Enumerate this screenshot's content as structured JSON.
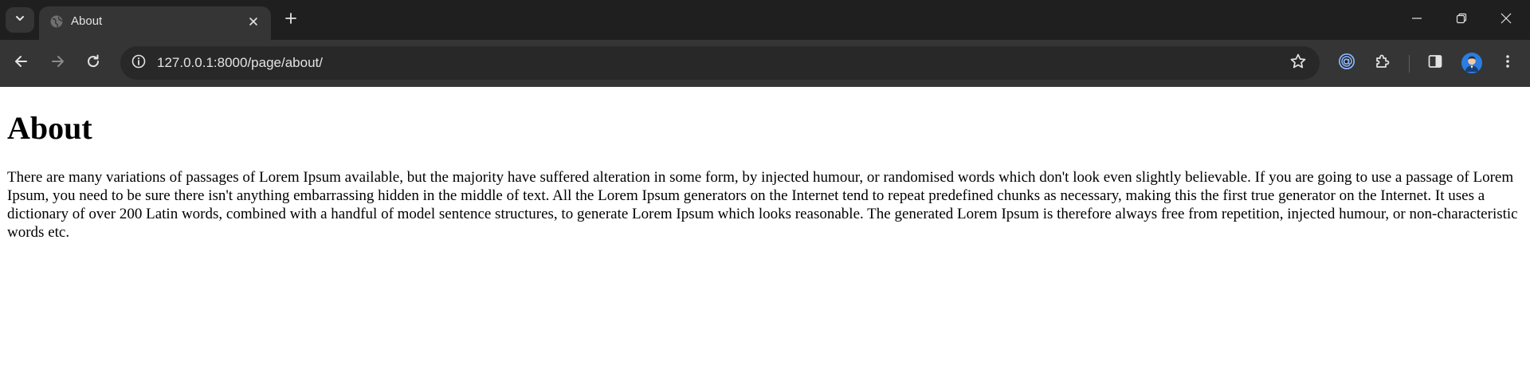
{
  "browser": {
    "tab": {
      "title": "About"
    },
    "address_bar": {
      "url": "127.0.0.1:8000/page/about/"
    },
    "icons": {
      "tab_search": "chevron-down-icon",
      "favicon": "globe-icon",
      "tab_close": "close-icon",
      "new_tab": "plus-icon",
      "minimize": "minimize-icon",
      "restore": "restore-icon",
      "close_window": "close-icon",
      "back": "arrow-left-icon",
      "forward": "arrow-right-icon",
      "reload": "reload-icon",
      "site_info": "info-icon",
      "bookmark": "star-icon",
      "extension_a": "at-sign-icon",
      "extensions": "puzzle-icon",
      "side_panel": "side-panel-icon",
      "profile": "avatar",
      "menu": "kebab-menu-icon"
    },
    "colors": {
      "tabstrip": "#1f1f1f",
      "active_tab": "#353535",
      "toolbar": "#353535",
      "omnibox": "#282828",
      "text": "#e3e3e3",
      "extension_accent": "#8ab4f8"
    }
  },
  "page": {
    "heading": "About",
    "body": "There are many variations of passages of Lorem Ipsum available, but the majority have suffered alteration in some form, by injected humour, or randomised words which don't look even slightly believable. If you are going to use a passage of Lorem Ipsum, you need to be sure there isn't anything embarrassing hidden in the middle of text. All the Lorem Ipsum generators on the Internet tend to repeat predefined chunks as necessary, making this the first true generator on the Internet. It uses a dictionary of over 200 Latin words, combined with a handful of model sentence structures, to generate Lorem Ipsum which looks reasonable. The generated Lorem Ipsum is therefore always free from repetition, injected humour, or non-characteristic words etc."
  }
}
